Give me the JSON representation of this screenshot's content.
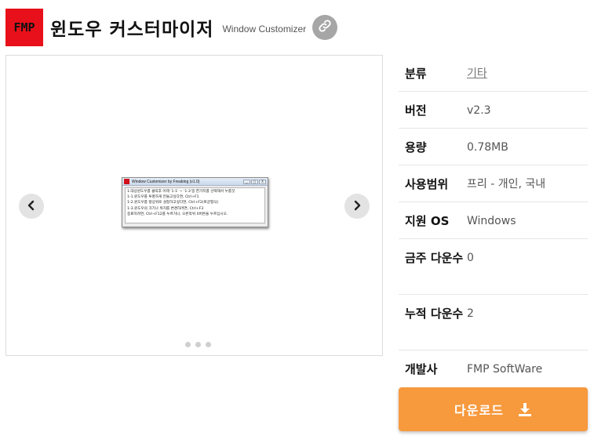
{
  "header": {
    "logo_text": "FMP",
    "title": "윈도우 커스터마이저",
    "subtitle": "Window Customizer",
    "link_icon": "link-icon"
  },
  "gallery": {
    "screenshot": {
      "window_title": "Window Customizer by Freabing (v1.0)",
      "window_buttons": [
        "__",
        "□",
        "X"
      ],
      "lines": [
        "1.대상윈도우를 클릭후 아래 '1-1' ~ '1-3'중 한가지를 선택해서 누를것",
        "1-1.윈도우를 투명하게 만들고싶다면, Ctrl+F1",
        "1-2.윈도우를 항상위로 설정하고싶다면, Ctrl+F2(토글형식)",
        "1-3.윈도우의 크기나 위치를 변경하려면, Ctrl+F3",
        "종료하려면, Ctrl+F12를 누르거나, 오른쪽위 X버튼을 누르십시오."
      ]
    },
    "prev_icon": "chevron-left-icon",
    "next_icon": "chevron-right-icon",
    "dot_count": 3
  },
  "info": {
    "rows": [
      {
        "label": "분류",
        "value": "기타"
      },
      {
        "label": "버전",
        "value": "v2.3"
      },
      {
        "label": "용량",
        "value": "0.78MB"
      },
      {
        "label": "사용범위",
        "value": "프리 - 개인, 국내"
      },
      {
        "label": "지원 OS",
        "value": "Windows"
      },
      {
        "label": "금주 다운수",
        "value": "0"
      },
      {
        "label": "누적 다운수",
        "value": "2"
      },
      {
        "label": "개발사",
        "value": "FMP SoftWare"
      }
    ]
  },
  "download": {
    "label": "다운로드",
    "icon": "download-icon"
  },
  "colors": {
    "logo_bg": "#e8101a",
    "download_bg": "#f7993d",
    "link_btn_bg": "#a6a6a6"
  }
}
